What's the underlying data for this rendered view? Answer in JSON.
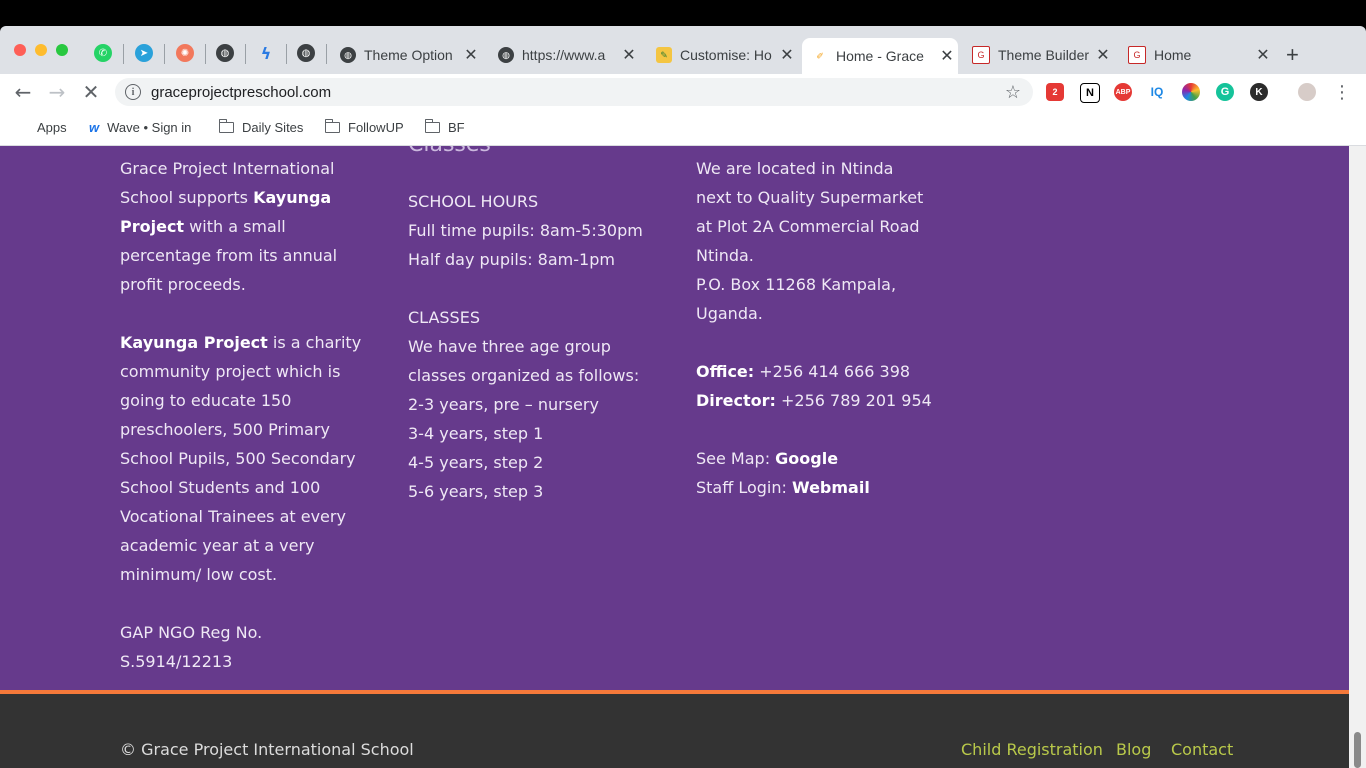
{
  "tabs": [
    {
      "label": "",
      "icon": "whatsapp-icon"
    },
    {
      "label": "",
      "icon": "telegram-icon"
    },
    {
      "label": "",
      "icon": "asana-icon"
    },
    {
      "label": "",
      "icon": "globe-icon"
    },
    {
      "label": "",
      "icon": "freshdesk-icon"
    },
    {
      "label": "",
      "icon": "globe-icon"
    },
    {
      "label": "Theme Option",
      "icon": "globe-icon"
    },
    {
      "label": "https://www.a",
      "icon": "globe-icon"
    },
    {
      "label": "Customise: Ho",
      "icon": "customizer-icon"
    },
    {
      "label": "Home - Grace",
      "icon": "school-icon",
      "active": true
    },
    {
      "label": "Theme Builder",
      "icon": "gtv-icon"
    },
    {
      "label": "Home",
      "icon": "gtv-icon"
    }
  ],
  "address": {
    "url": "graceprojectpreschool.com"
  },
  "extensions": {
    "badge_count": "2",
    "abp": "ABP",
    "iq": "IQ",
    "k": "K"
  },
  "bookmarks": [
    "Apps",
    "Wave • Sign in",
    "Daily Sites",
    "FollowUP",
    "BF"
  ],
  "footer_columns": {
    "about": {
      "p1_a": "Grace Project International School supports ",
      "p1_b": "Kayunga Project",
      "p1_c": " with a small percentage from its annual profit proceeds.",
      "p2_a": "Kayunga Project",
      "p2_b": " is a charity community project which is going to educate 150 preschoolers, 500 Primary School Pupils, 500 Secondary School Students and 100 Vocational Trainees at every academic year at a very minimum/ low cost.",
      "reg": "GAP NGO Reg No. S.5914/12213"
    },
    "classes": {
      "heading": "Classes",
      "hours_title": "SCHOOL HOURS",
      "full_time": "Full time pupils: 8am-5:30pm",
      "half_day": "Half day pupils: 8am-1pm",
      "classes_title": "CLASSES",
      "classes_intro": "We have three age group classes organized as follows:",
      "items": [
        "2-3 years, pre – nursery",
        "3-4 years, step 1",
        "4-5 years, step 2",
        "5-6 years, step 3"
      ]
    },
    "contact": {
      "location": "We are located in Ntinda next to Quality Supermarket at Plot 2A Commercial Road Ntinda.",
      "po_box": "P.O. Box 11268 Kampala, Uganda.",
      "office_label": "Office:",
      "office_phone": " +256 414 666 398",
      "director_label": "Director:",
      "director_phone": " +256 789 201 954",
      "map_label": "See Map: ",
      "map_link": "Google",
      "login_label": "Staff Login: ",
      "login_link": "Webmail"
    }
  },
  "bottom_bar": {
    "copyright": "© Grace Project International School",
    "links": [
      "Child Registration",
      "Blog",
      "Contact"
    ]
  },
  "colors": {
    "purple": "#663a8c",
    "orange": "#f5793a",
    "footer_dark": "#333333",
    "link_green": "#b9c94a"
  }
}
